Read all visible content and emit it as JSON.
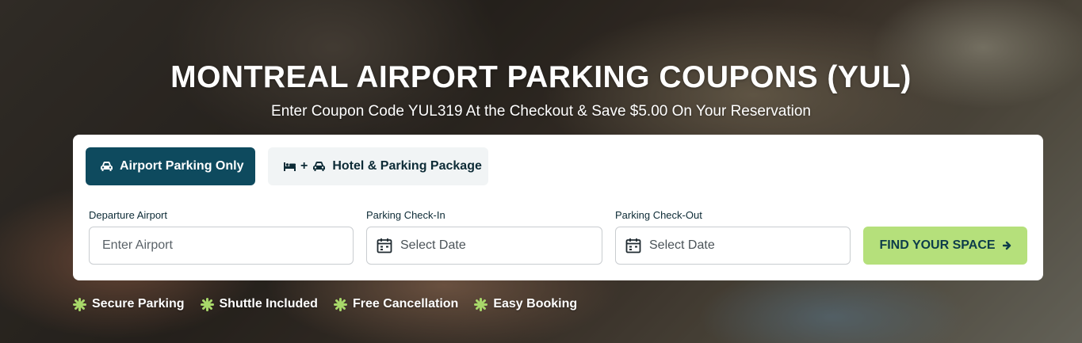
{
  "hero": {
    "title": "MONTREAL AIRPORT PARKING COUPONS (YUL)",
    "subtitle": "Enter Coupon Code YUL319 At the Checkout & Save $5.00 On Your Reservation"
  },
  "tabs": [
    {
      "label": "Airport Parking Only",
      "icons": [
        "car-icon"
      ],
      "active": true
    },
    {
      "label": "Hotel & Parking Package",
      "icons": [
        "bed-icon",
        "car-icon"
      ],
      "joiner": "+",
      "active": false
    }
  ],
  "form": {
    "departure_label": "Departure Airport",
    "departure_placeholder": "Enter Airport",
    "checkin_label": "Parking Check-In",
    "checkin_placeholder": "Select Date",
    "checkout_label": "Parking Check-Out",
    "checkout_placeholder": "Select Date",
    "submit_label": "FIND YOUR SPACE"
  },
  "features": [
    "Secure Parking",
    "Shuttle Included",
    "Free Cancellation",
    "Easy Booking"
  ],
  "colors": {
    "primary": "#0e4a5e",
    "accent": "#b5e07b",
    "feature_icon": "#a8d86a"
  }
}
